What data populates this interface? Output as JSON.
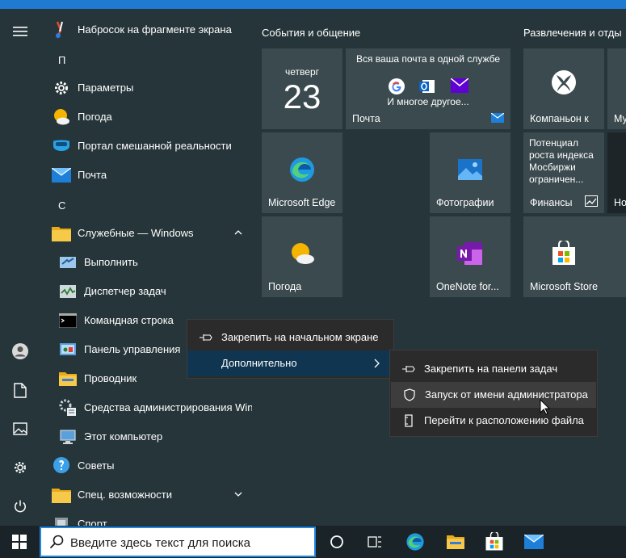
{
  "apps": {
    "snip": "Набросок на фрагменте экрана",
    "letter_p": "П",
    "settings": "Параметры",
    "weather": "Погода",
    "mr_portal": "Портал смешанной реальности",
    "mail": "Почта",
    "letter_s": "С",
    "win_tools": "Служебные — Windows",
    "run": "Выполнить",
    "taskmgr": "Диспетчер задач",
    "cmd": "Командная строка",
    "control_panel": "Панель управления",
    "explorer": "Проводник",
    "admin_tools": "Средства администрирования Win...",
    "this_pc": "Этот компьютер",
    "tips": "Советы",
    "accessibility": "Спец. возможности",
    "sport": "Спорт"
  },
  "groups": {
    "events": "События и общение",
    "entertainment": "Развлечения и отды"
  },
  "tiles": {
    "calendar_day": "четверг",
    "calendar_num": "23",
    "mail_header": "Вся ваша почта в одной службе",
    "mail_more": "И многое другое...",
    "mail_label": "Почта",
    "xbox_label": "Компаньон к",
    "partial_label": "Му",
    "edge_label": "Microsoft Edge",
    "photos_label": "Фотографии",
    "finance_text": "Потенциал роста индекса Мосбиржи ограничен...",
    "finance_label": "Финансы",
    "news_partial": "Но",
    "weather_label": "Погода",
    "onenote_label": "OneNote for...",
    "store_label": "Microsoft Store"
  },
  "context_menu": {
    "pin_start": "Закрепить на начальном экране",
    "more": "Дополнительно"
  },
  "submenu": {
    "pin_taskbar": "Закрепить на панели задач",
    "run_admin": "Запуск от имени администратора",
    "open_location": "Перейти к расположению файла"
  },
  "taskbar": {
    "search_placeholder": "Введите здесь текст для поиска"
  },
  "colors": {
    "accent": "#1e88e5",
    "tile": "#3b4a4e",
    "start_bg": "#263539",
    "menu_bg": "#2b2b2b",
    "menu_active": "#0f3550"
  }
}
